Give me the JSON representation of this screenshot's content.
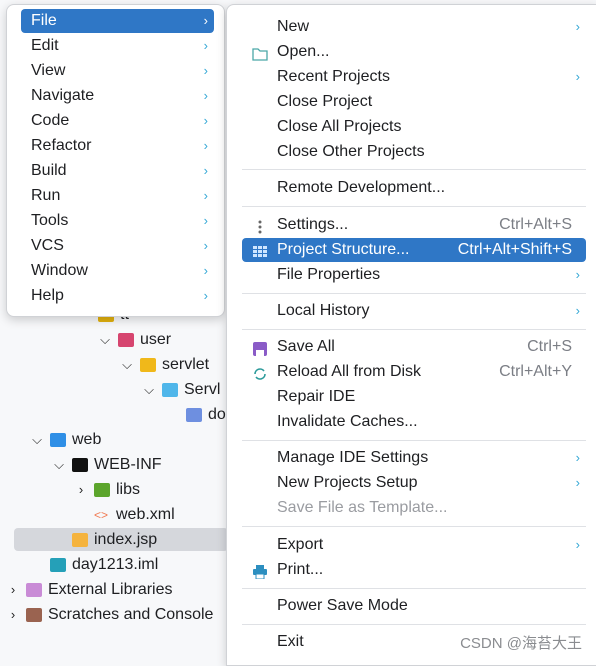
{
  "tree": {
    "items": [
      {
        "label": "tt",
        "chev": "",
        "icon": "folder-icon",
        "color": "#e2b10e"
      },
      {
        "label": "user",
        "chev": "⌄",
        "icon": "package-folder-icon",
        "color": "#d6456f"
      },
      {
        "label": "servlet",
        "chev": "⌄",
        "icon": "folder-icon",
        "color": "#f0b81a"
      },
      {
        "label": "Servl",
        "chev": "⌄",
        "icon": "interface-icon",
        "color": "#4fb6ea"
      },
      {
        "label": "do",
        "chev": "",
        "icon": "method-icon",
        "color": "#6e8fe0"
      },
      {
        "label": "web",
        "chev": "⌄",
        "icon": "web-folder-icon",
        "color": "#2f8fe6"
      },
      {
        "label": "WEB-INF",
        "chev": "⌄",
        "icon": "folder-icon",
        "color": "#111111"
      },
      {
        "label": "libs",
        "chev": "›",
        "icon": "library-folder-icon",
        "color": "#5ca52c"
      },
      {
        "label": "web.xml",
        "chev": "",
        "icon": "xml-icon",
        "color": "#f07a52"
      },
      {
        "label": "index.jsp",
        "chev": "",
        "icon": "jsp-icon",
        "color": "#f5b33d"
      },
      {
        "label": "day1213.iml",
        "chev": "",
        "icon": "iml-icon",
        "color": "#25a0b8"
      },
      {
        "label": "External Libraries",
        "chev": "›",
        "icon": "libraries-icon",
        "color": "#c98bd6"
      },
      {
        "label": "Scratches and Console",
        "chev": "›",
        "icon": "scratches-icon",
        "color": "#9a6350"
      }
    ]
  },
  "main_menu": {
    "items": [
      {
        "label": "File",
        "active": true
      },
      {
        "label": "Edit"
      },
      {
        "label": "View"
      },
      {
        "label": "Navigate"
      },
      {
        "label": "Code"
      },
      {
        "label": "Refactor"
      },
      {
        "label": "Build"
      },
      {
        "label": "Run"
      },
      {
        "label": "Tools"
      },
      {
        "label": "VCS"
      },
      {
        "label": "Window"
      },
      {
        "label": "Help"
      }
    ]
  },
  "file_menu": {
    "items": [
      {
        "label": "New",
        "submenu": true
      },
      {
        "label": "Open...",
        "icon": "folder-open-icon"
      },
      {
        "label": "Recent Projects",
        "submenu": true
      },
      {
        "label": "Close Project"
      },
      {
        "label": "Close All Projects"
      },
      {
        "label": "Close Other Projects"
      },
      {
        "label": "Remote Development..."
      },
      {
        "label": "Settings...",
        "shortcut": "Ctrl+Alt+S",
        "icon": "settings-dots-icon"
      },
      {
        "label": "Project Structure...",
        "shortcut": "Ctrl+Alt+Shift+S",
        "icon": "project-structure-icon",
        "highlighted": true
      },
      {
        "label": "File Properties",
        "submenu": true
      },
      {
        "label": "Local History",
        "submenu": true
      },
      {
        "label": "Save All",
        "shortcut": "Ctrl+S",
        "icon": "save-icon"
      },
      {
        "label": "Reload All from Disk",
        "shortcut": "Ctrl+Alt+Y",
        "icon": "reload-icon"
      },
      {
        "label": "Repair IDE"
      },
      {
        "label": "Invalidate Caches..."
      },
      {
        "label": "Manage IDE Settings",
        "submenu": true
      },
      {
        "label": "New Projects Setup",
        "submenu": true
      },
      {
        "label": "Save File as Template...",
        "disabled": true
      },
      {
        "label": "Export",
        "submenu": true
      },
      {
        "label": "Print...",
        "icon": "print-icon"
      },
      {
        "label": "Power Save Mode"
      },
      {
        "label": "Exit"
      }
    ]
  },
  "watermark": "CSDN @海苔大王",
  "colors": {
    "highlight": "#2f77c6",
    "submenu_arrow": "#35a8d6"
  }
}
